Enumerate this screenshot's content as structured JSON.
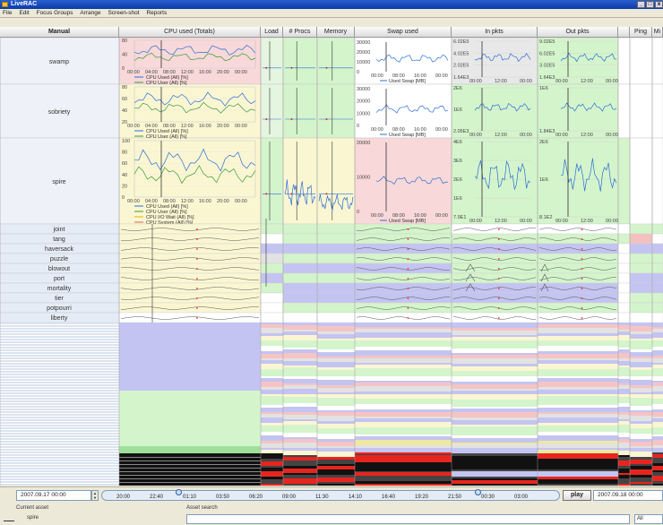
{
  "window": {
    "title": "LiveRAC",
    "controls": [
      "_",
      "□",
      "x"
    ]
  },
  "menu": [
    "File",
    "Edit",
    "Focus Groups",
    "Arrange",
    "Screen-shot",
    "Reports"
  ],
  "columns": {
    "manual": "Manual",
    "cpu": "CPU used (Totals)",
    "load": "Load",
    "procs": "# Procs",
    "memory": "Memory",
    "swap": "Swap used",
    "inpkts": "In pkts",
    "outpkts": "Out pkts",
    "ping": "Ping",
    "extra": "Mi"
  },
  "rows": {
    "large": [
      "swamp",
      "sobriety",
      "spire"
    ],
    "small": [
      "joint",
      "tang",
      "haversack",
      "puzzle",
      "blowout",
      "port",
      "mortality",
      "tier",
      "potpourri",
      "liberty"
    ]
  },
  "panel": {
    "cpu_yticks_swamp": [
      "80",
      "40",
      "0"
    ],
    "cpu_yticks_sobriety": [
      "80",
      "60",
      "40",
      "20"
    ],
    "cpu_yticks_spire": [
      "100",
      "80",
      "60",
      "40",
      "20",
      "0"
    ],
    "cpu_xticks": [
      "00:00",
      "04:00",
      "08:00",
      "12:00",
      "16:00",
      "20:00",
      "00:00"
    ],
    "cpu_legend_2": [
      "CPU Used (All) [%]",
      "CPU User (All) [%]"
    ],
    "cpu_legend_4": [
      "CPU Used (All) [%]",
      "CPU User (All) [%]",
      "CPU I/O Wait (All) [%]",
      "CPU System (All) [%]"
    ],
    "swap_yticks": [
      "30000",
      "20000",
      "10000",
      "0"
    ],
    "swap_yticks_spire": [
      "20000",
      "10000",
      "0"
    ],
    "swap_xticks": [
      "00:00",
      "08:00",
      "16:00",
      "00:00"
    ],
    "swap_legend": "Used Swap [MB]",
    "in_yticks_swamp": [
      "6.02E5",
      "4.02E5",
      "2.02E5",
      "1.64E3"
    ],
    "out_yticks_swamp": [
      "9.02E5",
      "6.02E5",
      "3.02E5",
      "1.64E3"
    ],
    "in_yticks_sobriety": [
      "2E6",
      "1E6",
      "2.05E3"
    ],
    "out_yticks_sobriety": [
      "1E6",
      "1.84E3"
    ],
    "in_yticks_spire": [
      "4E6",
      "3E6",
      "2E6",
      "1E6",
      "7.9E1"
    ],
    "out_yticks_spire": [
      "2E6",
      "1E6",
      "8.1E2"
    ],
    "pkt_xticks": [
      "00:00",
      "12:00",
      "00:00"
    ]
  },
  "timeline": {
    "start_date": "2007.09.17 00:00",
    "end_date": "2007.09.18 00:00",
    "ticks": [
      "20:00",
      "22:40",
      "01:10",
      "03:50",
      "06:20",
      "09:00",
      "11:30",
      "14:10",
      "16:40",
      "19:20",
      "21:50",
      "00:30",
      "03:00"
    ],
    "play_label": "play"
  },
  "bottom": {
    "current_asset_label": "Current asset",
    "current_asset_value": "spire",
    "asset_search_label": "Asset search",
    "search_value": "",
    "filter_value": "All"
  },
  "colors": {
    "pink": "#f8d8d8",
    "yellow": "#fbf6d2",
    "green": "#d4f4cc",
    "lavender": "#c4c4f2",
    "grey": "#e2e2e2",
    "red": "#e8241e",
    "black": "#111111",
    "line_blue": "#2b6fd6",
    "line_green": "#3a9a3a"
  }
}
